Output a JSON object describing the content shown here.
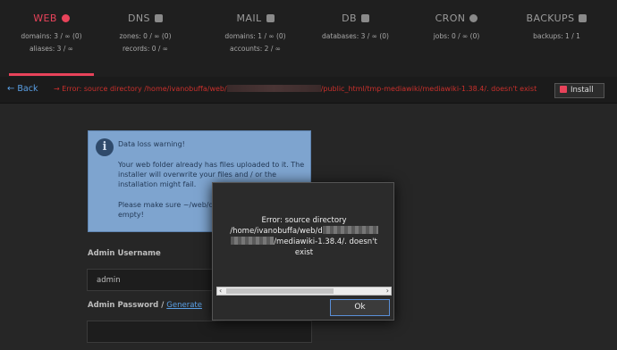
{
  "stats": [
    {
      "label": "WEB",
      "lines": [
        "domains: 3 / ∞ (0)",
        "aliases: 3 / ∞"
      ],
      "active": true,
      "icon": "globe-icon"
    },
    {
      "label": "DNS",
      "lines": [
        "zones: 0 / ∞ (0)",
        "records: 0 / ∞"
      ],
      "active": false,
      "icon": "list-icon"
    },
    {
      "label": "MAIL",
      "lines": [
        "domains: 1 / ∞ (0)",
        "accounts: 2 / ∞"
      ],
      "active": false,
      "icon": "mail-bulk-icon"
    },
    {
      "label": "DB",
      "lines": [
        "databases: 3 / ∞ (0)"
      ],
      "active": false,
      "icon": "database-icon"
    },
    {
      "label": "CRON",
      "lines": [
        "jobs: 0 / ∞ (0)"
      ],
      "active": false,
      "icon": "clock-icon"
    },
    {
      "label": "BACKUPS",
      "lines": [
        "backups: 1 / 1"
      ],
      "active": false,
      "icon": "file-archive-icon"
    }
  ],
  "toolbar": {
    "back_label": "Back",
    "error_prefix": "→ Error: source directory /home/ivanobuffa/web/",
    "error_suffix": "/public_html/tmp-mediawiki/mediawiki-1.38.4/. doesn't exist",
    "install_label": "Install"
  },
  "warning": {
    "title": "Data loss warning!",
    "body": "Your web folder already has files uploaded to it. The installer will overwrite your files and / or the installation might fail.",
    "note": "Please make sure ~/web/docuwiki.buffacloud... empty!"
  },
  "form": {
    "username_label": "Admin Username",
    "username_value": "admin",
    "password_label": "Admin Password / ",
    "generate_link": "Generate"
  },
  "dialog": {
    "line1": "Error: source directory",
    "line2": "/home/ivanobuffa/web/d",
    "line3": "/mediawiki-1.38.4/. doesn't",
    "line4": "exist",
    "ok_label": "Ok"
  },
  "colors": {
    "accent": "#e8435a",
    "link": "#5aa0e6",
    "error": "#c9302c"
  }
}
